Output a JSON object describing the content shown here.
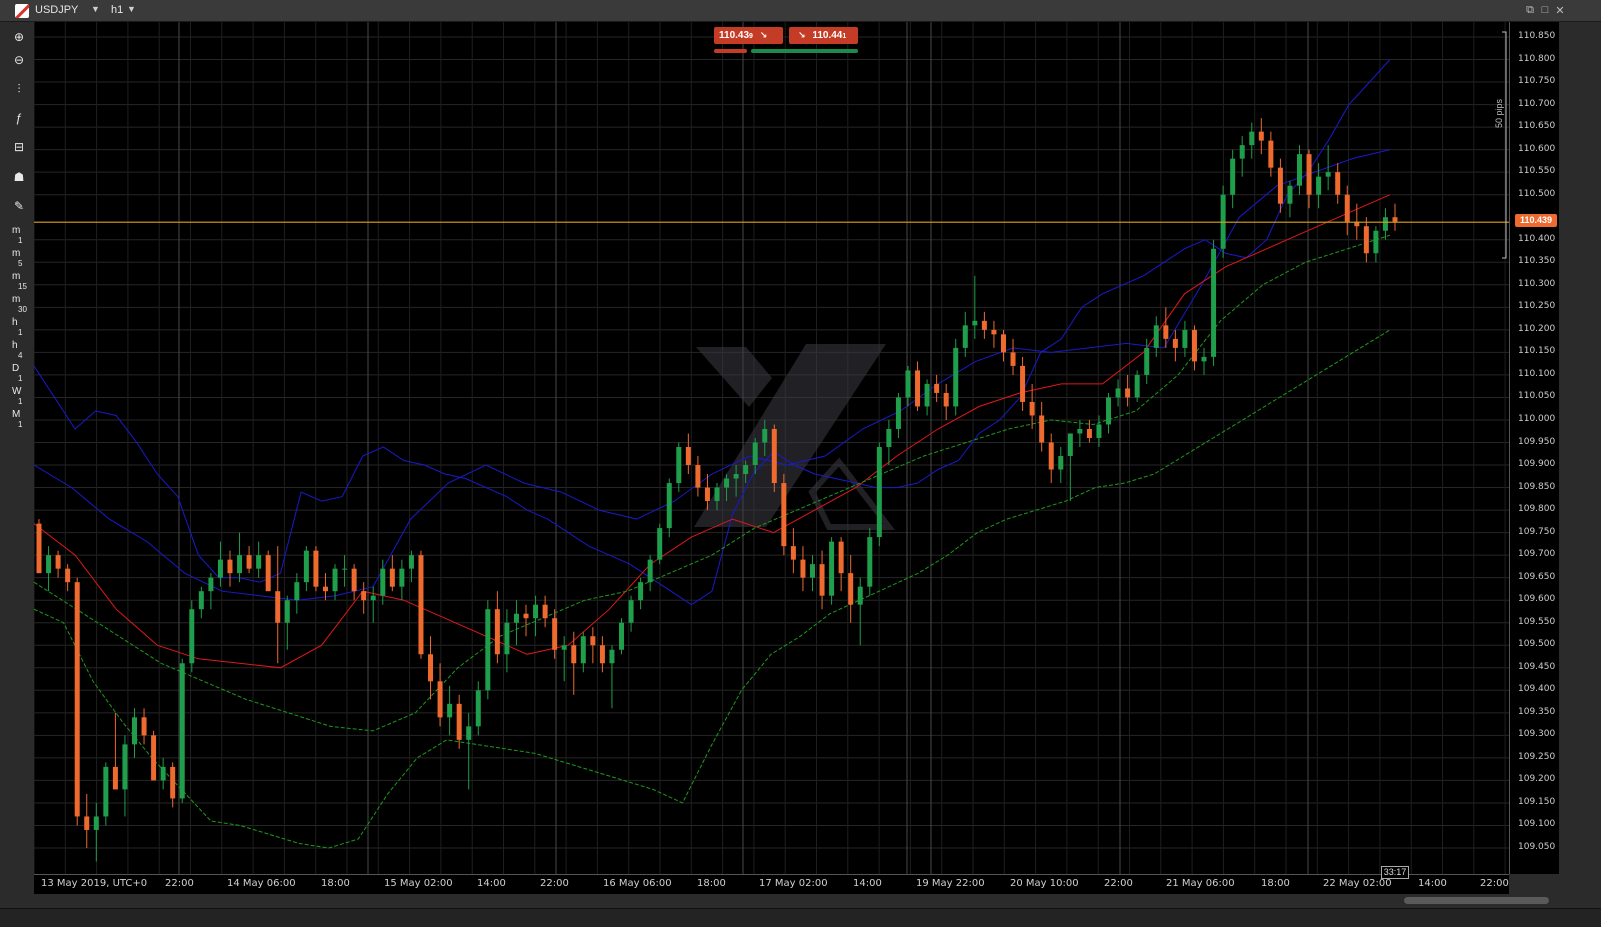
{
  "window": {
    "symbol": "USDJPY",
    "symbol_dropdown": "▼",
    "timeframe": "h1",
    "timeframe_dropdown": "▼",
    "btn_restore": "⧉",
    "btn_maximize": "□",
    "btn_close": "✕"
  },
  "toolbar": {
    "zoom_in": "⊕",
    "zoom_out": "⊖",
    "chart_type": "⫶",
    "indicators": "ƒ",
    "objects": "⊟",
    "templates": "☗",
    "tools": "✎",
    "timeframes": [
      {
        "main": "m",
        "sub": "1"
      },
      {
        "main": "m",
        "sub": "5"
      },
      {
        "main": "m",
        "sub": "15"
      },
      {
        "main": "m",
        "sub": "30"
      },
      {
        "main": "h",
        "sub": "1"
      },
      {
        "main": "h",
        "sub": "4"
      },
      {
        "main": "D",
        "sub": "1"
      },
      {
        "main": "W",
        "sub": "1"
      },
      {
        "main": "M",
        "sub": "1"
      }
    ]
  },
  "quick_trade": {
    "sell_price": "110.43",
    "sell_sup": "9",
    "sell_arrow": "↘",
    "buy_arrow": "↘",
    "buy_price": "110.44",
    "buy_sup": "1"
  },
  "current_price": "110.439",
  "countdown": "33:17",
  "pips_label": "50 pips",
  "colors": {
    "bull": "#1f9e4b",
    "bear": "#ee6a2f",
    "ema_red": "#e01818",
    "band_blue": "#1a1acc",
    "band_green": "#1c9a1c",
    "price_line": "#d9a21b"
  },
  "y_axis_labels": [
    "110.850",
    "110.800",
    "110.750",
    "110.700",
    "110.650",
    "110.600",
    "110.550",
    "110.500",
    "110.400",
    "110.350",
    "110.300",
    "110.250",
    "110.200",
    "110.150",
    "110.100",
    "110.050",
    "110.000",
    "109.950",
    "109.900",
    "109.850",
    "109.800",
    "109.750",
    "109.700",
    "109.650",
    "109.600",
    "109.550",
    "109.500",
    "109.450",
    "109.400",
    "109.350",
    "109.300",
    "109.250",
    "109.200",
    "109.150",
    "109.100",
    "109.050"
  ],
  "x_axis_labels": [
    "13 May 2019, UTC+0",
    "22:00",
    "14 May 06:00",
    "18:00",
    "15 May 02:00",
    "14:00",
    "22:00",
    "16 May 06:00",
    "18:00",
    "17 May 02:00",
    "14:00",
    "19 May 22:00",
    "20 May 10:00",
    "22:00",
    "21 May 06:00",
    "18:00",
    "22 May 02:00",
    "14:00",
    "22:00"
  ],
  "chart_data": {
    "type": "candlestick",
    "symbol": "USDJPY",
    "timeframe": "h1",
    "ylim": [
      109.0,
      110.875
    ],
    "current_price": 110.439,
    "candles": [
      [
        109.77,
        109.78,
        109.66,
        109.66
      ],
      [
        109.66,
        109.72,
        109.62,
        109.7
      ],
      [
        109.7,
        109.71,
        109.65,
        109.67
      ],
      [
        109.67,
        109.68,
        109.62,
        109.64
      ],
      [
        109.64,
        109.65,
        109.1,
        109.12
      ],
      [
        109.12,
        109.17,
        109.05,
        109.09
      ],
      [
        109.09,
        109.15,
        109.02,
        109.12
      ],
      [
        109.12,
        109.24,
        109.1,
        109.23
      ],
      [
        109.23,
        109.35,
        109.2,
        109.18
      ],
      [
        109.18,
        109.3,
        109.12,
        109.28
      ],
      [
        109.28,
        109.36,
        109.25,
        109.34
      ],
      [
        109.34,
        109.36,
        109.28,
        109.3
      ],
      [
        109.3,
        109.31,
        109.2,
        109.2
      ],
      [
        109.2,
        109.25,
        109.18,
        109.23
      ],
      [
        109.23,
        109.24,
        109.14,
        109.16
      ],
      [
        109.16,
        109.47,
        109.15,
        109.46
      ],
      [
        109.46,
        109.6,
        109.44,
        109.58
      ],
      [
        109.58,
        109.63,
        109.56,
        109.62
      ],
      [
        109.62,
        109.66,
        109.58,
        109.65
      ],
      [
        109.65,
        109.73,
        109.63,
        109.69
      ],
      [
        109.69,
        109.71,
        109.63,
        109.66
      ],
      [
        109.66,
        109.75,
        109.64,
        109.7
      ],
      [
        109.7,
        109.72,
        109.66,
        109.67
      ],
      [
        109.67,
        109.73,
        109.65,
        109.7
      ],
      [
        109.7,
        109.71,
        109.64,
        109.62
      ],
      [
        109.62,
        109.72,
        109.46,
        109.55
      ],
      [
        109.55,
        109.61,
        109.49,
        109.6
      ],
      [
        109.6,
        109.66,
        109.57,
        109.64
      ],
      [
        109.64,
        109.72,
        109.62,
        109.71
      ],
      [
        109.71,
        109.72,
        109.62,
        109.63
      ],
      [
        109.63,
        109.66,
        109.6,
        109.62
      ],
      [
        109.62,
        109.68,
        109.6,
        109.67
      ],
      [
        109.67,
        109.7,
        109.63,
        109.67
      ],
      [
        109.67,
        109.68,
        109.6,
        109.62
      ],
      [
        109.62,
        109.64,
        109.57,
        109.6
      ],
      [
        109.6,
        109.63,
        109.55,
        109.61
      ],
      [
        109.61,
        109.69,
        109.59,
        109.67
      ],
      [
        109.67,
        109.7,
        109.62,
        109.63
      ],
      [
        109.63,
        109.69,
        109.6,
        109.67
      ],
      [
        109.67,
        109.71,
        109.64,
        109.7
      ],
      [
        109.7,
        109.71,
        109.47,
        109.48
      ],
      [
        109.48,
        109.52,
        109.38,
        109.42
      ],
      [
        109.42,
        109.46,
        109.32,
        109.34
      ],
      [
        109.34,
        109.41,
        109.3,
        109.37
      ],
      [
        109.37,
        109.39,
        109.27,
        109.29
      ],
      [
        109.29,
        109.35,
        109.18,
        109.32
      ],
      [
        109.32,
        109.42,
        109.3,
        109.4
      ],
      [
        109.4,
        109.6,
        109.38,
        109.58
      ],
      [
        109.58,
        109.62,
        109.46,
        109.48
      ],
      [
        109.48,
        109.58,
        109.44,
        109.55
      ],
      [
        109.55,
        109.6,
        109.5,
        109.57
      ],
      [
        109.57,
        109.59,
        109.52,
        109.56
      ],
      [
        109.56,
        109.61,
        109.52,
        109.59
      ],
      [
        109.59,
        109.61,
        109.54,
        109.56
      ],
      [
        109.56,
        109.58,
        109.47,
        109.49
      ],
      [
        109.49,
        109.52,
        109.42,
        109.5
      ],
      [
        109.5,
        109.53,
        109.39,
        109.46
      ],
      [
        109.46,
        109.53,
        109.44,
        109.52
      ],
      [
        109.52,
        109.54,
        109.46,
        109.5
      ],
      [
        109.5,
        109.52,
        109.44,
        109.46
      ],
      [
        109.46,
        109.5,
        109.36,
        109.49
      ],
      [
        109.49,
        109.56,
        109.48,
        109.55
      ],
      [
        109.55,
        109.61,
        109.53,
        109.6
      ],
      [
        109.6,
        109.65,
        109.58,
        109.64
      ],
      [
        109.64,
        109.7,
        109.62,
        109.69
      ],
      [
        109.69,
        109.77,
        109.68,
        109.76
      ],
      [
        109.76,
        109.87,
        109.74,
        109.86
      ],
      [
        109.86,
        109.95,
        109.84,
        109.94
      ],
      [
        109.94,
        109.97,
        109.88,
        109.9
      ],
      [
        109.9,
        109.92,
        109.83,
        109.85
      ],
      [
        109.85,
        109.88,
        109.8,
        109.82
      ],
      [
        109.82,
        109.86,
        109.8,
        109.85
      ],
      [
        109.85,
        109.88,
        109.82,
        109.87
      ],
      [
        109.87,
        109.9,
        109.83,
        109.88
      ],
      [
        109.88,
        109.91,
        109.86,
        109.9
      ],
      [
        109.9,
        109.96,
        109.88,
        109.95
      ],
      [
        109.95,
        110.0,
        109.92,
        109.98
      ],
      [
        109.98,
        109.99,
        109.84,
        109.86
      ],
      [
        109.86,
        109.88,
        109.7,
        109.72
      ],
      [
        109.72,
        109.76,
        109.66,
        109.69
      ],
      [
        109.69,
        109.72,
        109.62,
        109.65
      ],
      [
        109.65,
        109.7,
        109.62,
        109.68
      ],
      [
        109.68,
        109.71,
        109.58,
        109.61
      ],
      [
        109.61,
        109.74,
        109.59,
        109.73
      ],
      [
        109.73,
        109.74,
        109.62,
        109.66
      ],
      [
        109.66,
        109.7,
        109.55,
        109.59
      ],
      [
        109.59,
        109.65,
        109.5,
        109.63
      ],
      [
        109.63,
        109.76,
        109.61,
        109.74
      ],
      [
        109.74,
        109.95,
        109.72,
        109.94
      ],
      [
        109.94,
        110.0,
        109.9,
        109.98
      ],
      [
        109.98,
        110.06,
        109.96,
        110.05
      ],
      [
        110.05,
        110.12,
        110.03,
        110.11
      ],
      [
        110.11,
        110.13,
        110.02,
        110.03
      ],
      [
        110.03,
        110.09,
        110.01,
        110.08
      ],
      [
        110.08,
        110.1,
        110.04,
        110.06
      ],
      [
        110.06,
        110.08,
        110.0,
        110.03
      ],
      [
        110.03,
        110.18,
        110.01,
        110.16
      ],
      [
        110.16,
        110.24,
        110.14,
        110.21
      ],
      [
        110.21,
        110.32,
        110.18,
        110.22
      ],
      [
        110.22,
        110.24,
        110.18,
        110.2
      ],
      [
        110.2,
        110.22,
        110.16,
        110.19
      ],
      [
        110.19,
        110.2,
        110.13,
        110.15
      ],
      [
        110.15,
        110.18,
        110.1,
        110.12
      ],
      [
        110.12,
        110.14,
        110.02,
        110.04
      ],
      [
        110.04,
        110.08,
        109.98,
        110.01
      ],
      [
        110.01,
        110.04,
        109.93,
        109.95
      ],
      [
        109.95,
        109.97,
        109.86,
        109.89
      ],
      [
        109.89,
        109.94,
        109.86,
        109.92
      ],
      [
        109.92,
        109.95,
        109.82,
        109.97
      ],
      [
        109.97,
        110.0,
        109.94,
        109.98
      ],
      [
        109.98,
        110.0,
        109.95,
        109.96
      ],
      [
        109.96,
        110.01,
        109.94,
        109.99
      ],
      [
        109.99,
        110.06,
        109.97,
        110.05
      ],
      [
        110.05,
        110.09,
        110.03,
        110.07
      ],
      [
        110.07,
        110.1,
        110.03,
        110.05
      ],
      [
        110.05,
        110.11,
        110.04,
        110.1
      ],
      [
        110.1,
        110.18,
        110.08,
        110.16
      ],
      [
        110.16,
        110.23,
        110.14,
        110.21
      ],
      [
        110.21,
        110.25,
        110.16,
        110.18
      ],
      [
        110.18,
        110.2,
        110.13,
        110.16
      ],
      [
        110.16,
        110.22,
        110.14,
        110.2
      ],
      [
        110.2,
        110.21,
        110.11,
        110.13
      ],
      [
        110.13,
        110.16,
        110.1,
        110.14
      ],
      [
        110.14,
        110.4,
        110.12,
        110.38
      ],
      [
        110.38,
        110.52,
        110.36,
        110.5
      ],
      [
        110.5,
        110.6,
        110.47,
        110.58
      ],
      [
        110.58,
        110.63,
        110.54,
        110.61
      ],
      [
        110.61,
        110.66,
        110.58,
        110.64
      ],
      [
        110.64,
        110.67,
        110.59,
        110.62
      ],
      [
        110.62,
        110.64,
        110.54,
        110.56
      ],
      [
        110.56,
        110.58,
        110.46,
        110.48
      ],
      [
        110.48,
        110.53,
        110.45,
        110.52
      ],
      [
        110.52,
        110.61,
        110.5,
        110.59
      ],
      [
        110.59,
        110.6,
        110.47,
        110.5
      ],
      [
        110.5,
        110.57,
        110.47,
        110.54
      ],
      [
        110.54,
        110.61,
        110.51,
        110.55
      ],
      [
        110.55,
        110.57,
        110.48,
        110.5
      ],
      [
        110.5,
        110.52,
        110.41,
        110.44
      ],
      [
        110.44,
        110.48,
        110.4,
        110.43
      ],
      [
        110.43,
        110.45,
        110.35,
        110.37
      ],
      [
        110.37,
        110.43,
        110.35,
        110.42
      ],
      [
        110.42,
        110.47,
        110.4,
        110.45
      ],
      [
        110.45,
        110.48,
        110.42,
        110.44
      ]
    ],
    "bollinger_outer": {
      "upper": [
        110.12,
        110.05,
        109.98,
        110.02,
        110.01,
        109.95,
        109.88,
        109.83,
        109.7,
        109.65,
        109.65,
        109.64,
        109.66,
        109.84,
        109.82,
        109.83,
        109.92,
        109.94,
        109.91,
        109.9,
        109.88,
        109.87,
        109.85,
        109.83,
        109.8,
        109.78,
        109.75,
        109.72,
        109.7,
        109.68,
        109.65,
        109.62,
        109.59,
        109.62,
        109.79,
        109.88,
        109.93,
        109.9,
        109.88,
        109.87,
        109.86,
        109.85,
        109.85,
        109.86,
        109.89,
        109.91,
        109.97,
        110.0,
        110.05,
        110.15,
        110.18,
        110.25,
        110.28,
        110.3,
        110.32,
        110.35,
        110.38,
        110.4,
        110.37,
        110.36,
        110.4,
        110.5,
        110.55,
        110.62,
        110.7,
        110.75,
        110.8
      ],
      "lower": [
        109.58,
        109.55,
        109.42,
        109.33,
        109.25,
        109.18,
        109.11,
        109.1,
        109.08,
        109.06,
        109.05,
        109.07,
        109.17,
        109.25,
        109.29,
        109.28,
        109.27,
        109.26,
        109.24,
        109.22,
        109.2,
        109.18,
        109.15,
        109.28,
        109.4,
        109.48,
        109.52,
        109.57,
        109.6,
        109.63,
        109.66,
        109.7,
        109.75,
        109.78,
        109.8,
        109.82,
        109.85,
        109.86,
        109.88,
        109.92,
        109.96,
        110.0,
        110.04,
        110.08,
        110.12,
        110.16,
        110.2
      ]
    },
    "bollinger_inner": {
      "upper": [
        109.9,
        109.85,
        109.78,
        109.73,
        109.66,
        109.62,
        109.61,
        109.6,
        109.61,
        109.63,
        109.78,
        109.86,
        109.9,
        109.86,
        109.84,
        109.8,
        109.78,
        109.82,
        109.88,
        109.92,
        109.9,
        109.92,
        109.98,
        110.02,
        110.08,
        110.13,
        110.16,
        110.15,
        110.16,
        110.17,
        110.16,
        110.3,
        110.45,
        110.52,
        110.55,
        110.58,
        110.6
      ],
      "lower": [
        109.64,
        109.58,
        109.52,
        109.46,
        109.42,
        109.38,
        109.35,
        109.32,
        109.31,
        109.35,
        109.45,
        109.52,
        109.56,
        109.6,
        109.62,
        109.66,
        109.7,
        109.76,
        109.8,
        109.84,
        109.88,
        109.92,
        109.95,
        109.98,
        110.0,
        109.99,
        110.02,
        110.1,
        110.22,
        110.3,
        110.35,
        110.38,
        110.41
      ]
    },
    "ema": [
      109.77,
      109.7,
      109.58,
      109.5,
      109.47,
      109.46,
      109.45,
      109.5,
      109.62,
      109.6,
      109.56,
      109.52,
      109.48,
      109.5,
      109.58,
      109.68,
      109.74,
      109.78,
      109.75,
      109.8,
      109.85,
      109.92,
      109.98,
      110.03,
      110.06,
      110.08,
      110.08,
      110.15,
      110.28,
      110.34,
      110.38,
      110.42,
      110.46,
      110.5
    ]
  }
}
